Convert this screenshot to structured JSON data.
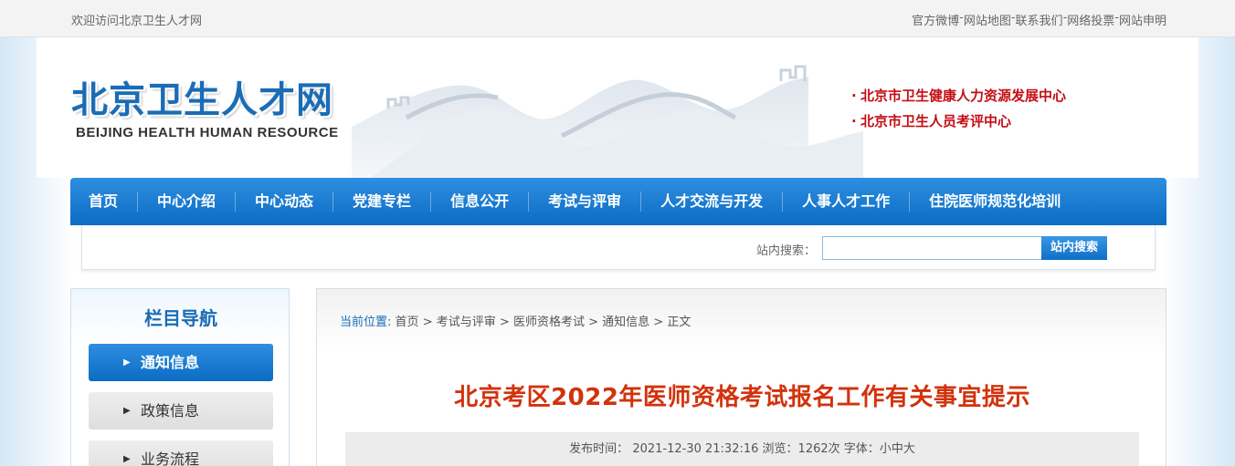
{
  "topbar": {
    "welcome": "欢迎访问北京卫生人才网",
    "links": [
      "官方微博",
      "网站地图",
      "联系我们",
      "网络投票",
      "网站申明"
    ],
    "separator": "-"
  },
  "header": {
    "logo_cn": "北京卫生人才网",
    "logo_en": "BEIJING HEALTH HUMAN RESOURCE",
    "orgs": [
      "北京市卫生健康人力资源发展中心",
      "北京市卫生人员考评中心"
    ]
  },
  "nav": {
    "items": [
      "首页",
      "中心介绍",
      "中心动态",
      "党建专栏",
      "信息公开",
      "考试与评审",
      "人才交流与开发",
      "人事人才工作",
      "住院医师规范化培训"
    ]
  },
  "search": {
    "label": "站内搜索：",
    "value": "",
    "button": "站内搜索"
  },
  "sidebar": {
    "title": "栏目导航",
    "items": [
      {
        "label": "通知信息",
        "active": true
      },
      {
        "label": "政策信息",
        "active": false
      },
      {
        "label": "业务流程",
        "active": false
      }
    ]
  },
  "breadcrumb": {
    "prefix": "当前位置:",
    "items": [
      "首页",
      "考试与评审",
      "医师资格考试",
      "通知信息",
      "正文"
    ],
    "separator": ">"
  },
  "article": {
    "title": "北京考区2022年医师资格考试报名工作有关事宜提示",
    "publish_label": "发布时间：",
    "publish_time": "2021-12-30 21:32:16",
    "views_label": "浏览：",
    "views": "1262次",
    "font_label": "字体：",
    "font_sizes": [
      "小",
      "中",
      "大"
    ]
  },
  "colors": {
    "brand_blue": "#1a6cb6",
    "nav_blue": "#0b6cc4",
    "org_red": "#c40d14",
    "title_red": "#d1330c"
  }
}
